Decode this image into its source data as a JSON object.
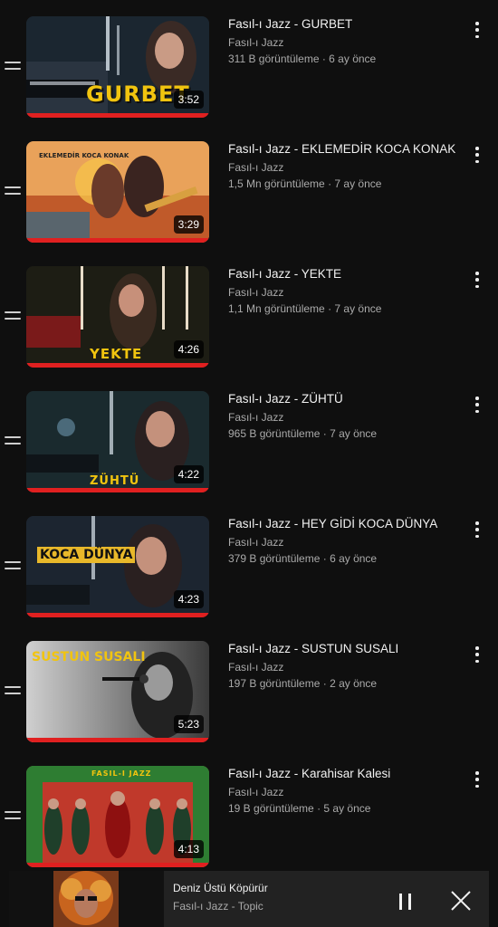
{
  "videos": [
    {
      "title": "Fasıl-ı Jazz - GURBET",
      "channel": "Fasıl-ı Jazz",
      "stats": "311 B görüntüleme · 6 ay önce",
      "duration": "3:52",
      "overlay": "GURBET",
      "watched_fraction": 1.0
    },
    {
      "title": "Fasıl-ı Jazz - EKLEMEDİR KOCA KONAK",
      "channel": "Fasıl-ı Jazz",
      "stats": "1,5 Mn görüntüleme · 7 ay önce",
      "duration": "3:29",
      "overlay": "EKLEMEDİR KOCA KONAK",
      "watched_fraction": 1.0
    },
    {
      "title": "Fasıl-ı Jazz - YEKTE",
      "channel": "Fasıl-ı Jazz",
      "stats": "1,1 Mn görüntüleme · 7 ay önce",
      "duration": "4:26",
      "overlay": "YEKTE",
      "watched_fraction": 1.0
    },
    {
      "title": "Fasıl-ı Jazz - ZÜHTÜ",
      "channel": "Fasıl-ı Jazz",
      "stats": "965 B görüntüleme · 7 ay önce",
      "duration": "4:22",
      "overlay": "ZÜHTÜ",
      "watched_fraction": 1.0
    },
    {
      "title": "Fasıl-ı Jazz - HEY GİDİ KOCA DÜNYA",
      "channel": "Fasıl-ı Jazz",
      "stats": "379 B görüntüleme · 6 ay önce",
      "duration": "4:23",
      "overlay": "KOCA DÜNYA",
      "watched_fraction": 1.0
    },
    {
      "title": "Fasıl-ı Jazz - SUSTUN SUSALI",
      "channel": "Fasıl-ı Jazz",
      "stats": "197 B görüntüleme · 2 ay önce",
      "duration": "5:23",
      "overlay": "SUSTUN SUSALI",
      "watched_fraction": 1.0
    },
    {
      "title": "Fasıl-ı Jazz - Karahisar Kalesi",
      "channel": "Fasıl-ı Jazz",
      "stats": "19 B görüntüleme · 5 ay önce",
      "duration": "4:13",
      "overlay": "FASIL-I JAZZ",
      "watched_fraction": 1.0
    }
  ],
  "mini_player": {
    "title": "Deniz Üstü Köpürür",
    "subtitle": "Fasıl-ı Jazz - Topic"
  },
  "colors": {
    "background": "#0f0f0f",
    "progress": "#e02020",
    "text_primary": "#f1f1f1",
    "text_secondary": "#aaaaaa"
  },
  "icons": {
    "drag": "drag-handle-icon",
    "more": "more-vert-icon",
    "pause": "pause-icon",
    "close": "close-icon"
  }
}
